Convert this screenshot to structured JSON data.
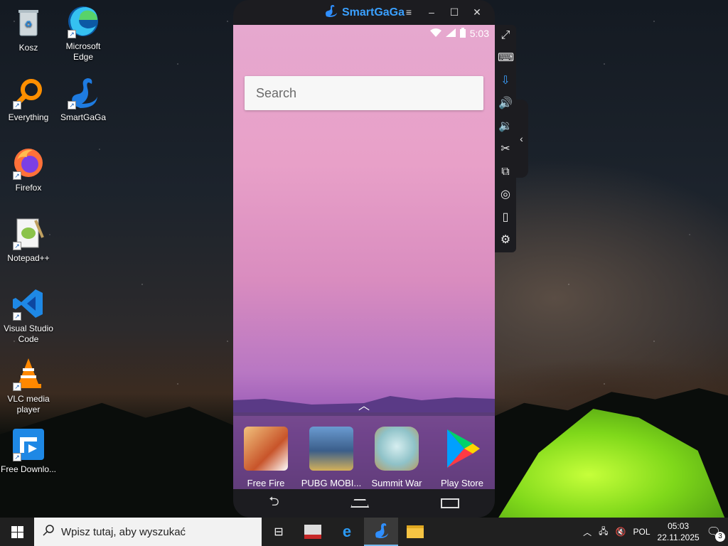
{
  "desktop": {
    "icons": [
      {
        "label": "Kosz",
        "icon": "recycle-bin-icon"
      },
      {
        "label": "Microsoft Edge",
        "icon": "edge-icon"
      },
      {
        "label": "Everything",
        "icon": "everything-search-icon"
      },
      {
        "label": "SmartGaGa",
        "icon": "smartgaga-swan-icon"
      },
      {
        "label": "Firefox",
        "icon": "firefox-icon"
      },
      {
        "label": "Notepad++",
        "icon": "notepadpp-icon"
      },
      {
        "label": "Visual Studio Code",
        "icon": "vscode-icon"
      },
      {
        "label": "VLC media player",
        "icon": "vlc-icon"
      },
      {
        "label": "Free Downlo...",
        "icon": "free-download-manager-icon"
      }
    ]
  },
  "emulator": {
    "brand": "SmartGaGa",
    "window_controls": [
      "menu-icon",
      "minimize-icon",
      "maximize-icon",
      "close-icon"
    ],
    "status_time": "5:03",
    "search_placeholder": "Search",
    "dock_apps": [
      {
        "label": "Free Fire",
        "color": "#c8542a"
      },
      {
        "label": "PUBG MOBI...",
        "color": "#3b5e8a"
      },
      {
        "label": "Summit War",
        "color": "#8fc2c8"
      },
      {
        "label": "Play Store",
        "color": "#ffffff"
      }
    ],
    "toolbar": [
      "fullscreen-icon",
      "keyboard-icon",
      "apk-install-icon",
      "volume-up-icon",
      "volume-down-icon",
      "screenshot-scissors-icon",
      "multi-instance-icon",
      "location-icon",
      "shake-icon",
      "settings-icon"
    ]
  },
  "taskbar": {
    "search_placeholder": "Wpisz tutaj, aby wyszukać",
    "language": "POL",
    "time": "05:03",
    "date": "22.11.2025",
    "notifications": "3"
  }
}
